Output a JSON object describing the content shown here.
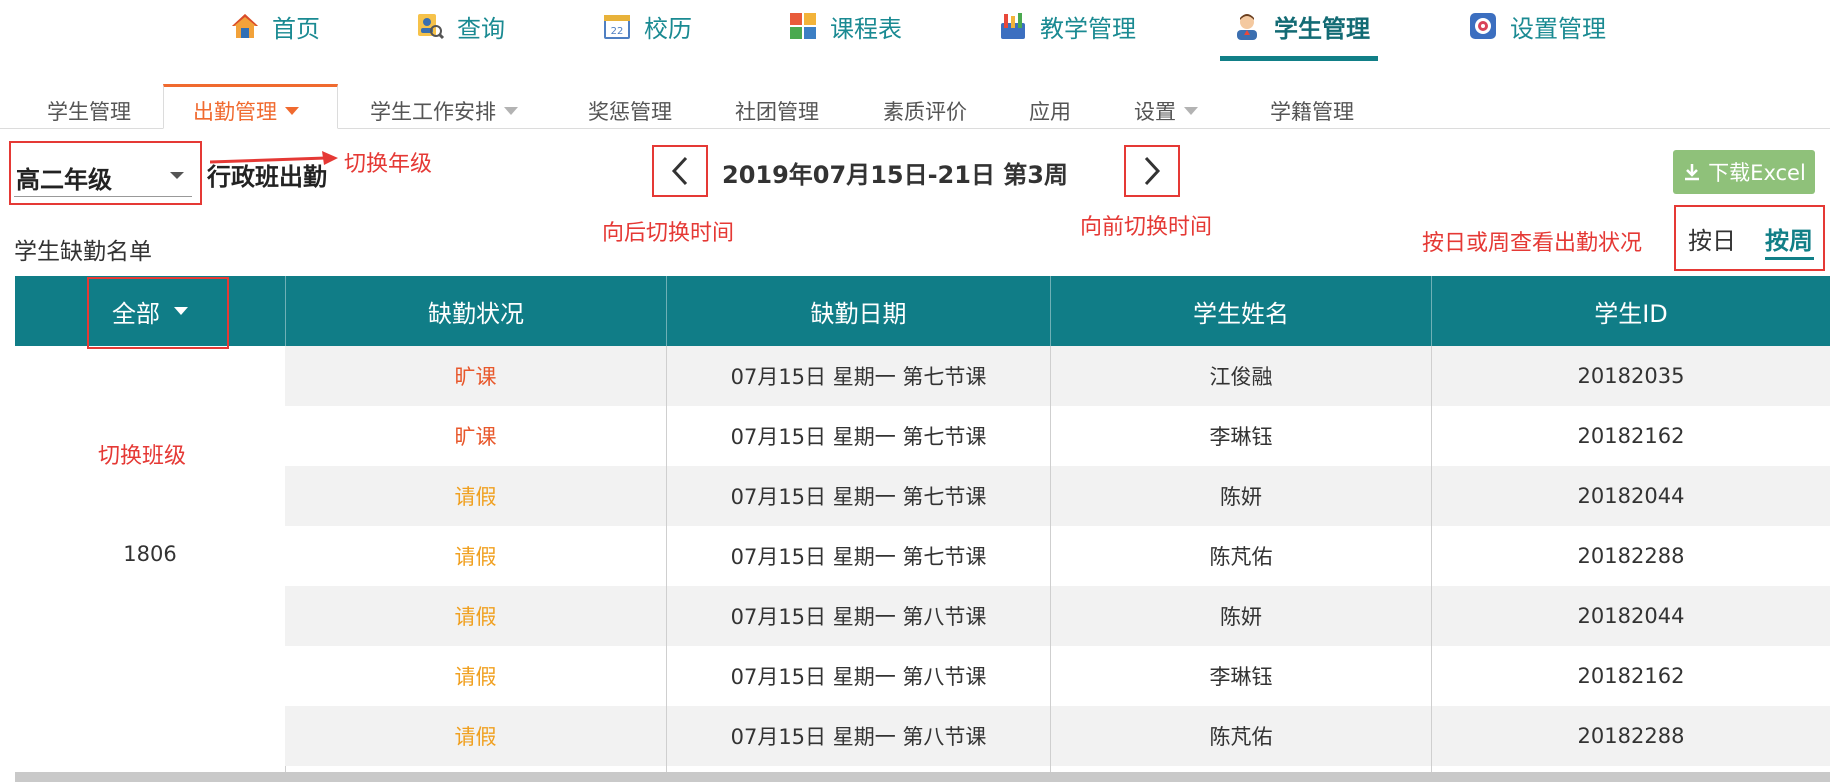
{
  "top_nav": {
    "items": [
      {
        "label": "首页",
        "icon": "home-icon"
      },
      {
        "label": "查询",
        "icon": "search-user-icon"
      },
      {
        "label": "校历",
        "icon": "calendar-icon"
      },
      {
        "label": "课程表",
        "icon": "timetable-icon"
      },
      {
        "label": "教学管理",
        "icon": "teaching-icon"
      },
      {
        "label": "学生管理",
        "icon": "student-icon"
      },
      {
        "label": "设置管理",
        "icon": "gear-icon"
      }
    ],
    "active_index": 5,
    "accent_color": "#117f87"
  },
  "sub_nav": {
    "items": [
      {
        "label": "学生管理",
        "has_dropdown": false
      },
      {
        "label": "出勤管理",
        "has_dropdown": true
      },
      {
        "label": "学生工作安排",
        "has_dropdown": true
      },
      {
        "label": "奖惩管理",
        "has_dropdown": false
      },
      {
        "label": "社团管理",
        "has_dropdown": false
      },
      {
        "label": "素质评价",
        "has_dropdown": false
      },
      {
        "label": "应用",
        "has_dropdown": false
      },
      {
        "label": "设置",
        "has_dropdown": true
      },
      {
        "label": "学籍管理",
        "has_dropdown": false
      }
    ],
    "active_index": 1,
    "active_color": "#f06a2f"
  },
  "toolbar": {
    "grade_selected": "高二年级",
    "attendance_title": "行政班出勤",
    "date_range": "2019年07月15日-21日 第3周",
    "download_label": "下载Excel",
    "view_day_label": "按日",
    "view_week_label": "按周",
    "absent_list_title": "学生缺勤名单"
  },
  "annotations": {
    "switch_grade": "切换年级",
    "prev_time": "向后切换时间",
    "next_time": "向前切换时间",
    "view_mode": "按日或周查看出勤状况",
    "switch_class": "切换班级"
  },
  "table": {
    "class_filter": "全部",
    "headers": [
      "缺勤状况",
      "缺勤日期",
      "学生姓名",
      "学生ID"
    ],
    "class_name": "1806",
    "rows": [
      {
        "status": "旷课",
        "status_type": "truant",
        "date": "07月15日 星期一 第七节课",
        "name": "江俊融",
        "id": "20182035"
      },
      {
        "status": "旷课",
        "status_type": "truant",
        "date": "07月15日 星期一 第七节课",
        "name": "李琳钰",
        "id": "20182162"
      },
      {
        "status": "请假",
        "status_type": "leave",
        "date": "07月15日 星期一 第七节课",
        "name": "陈妍",
        "id": "20182044"
      },
      {
        "status": "请假",
        "status_type": "leave",
        "date": "07月15日 星期一 第七节课",
        "name": "陈芃佑",
        "id": "20182288"
      },
      {
        "status": "请假",
        "status_type": "leave",
        "date": "07月15日 星期一 第八节课",
        "name": "陈妍",
        "id": "20182044"
      },
      {
        "status": "请假",
        "status_type": "leave",
        "date": "07月15日 星期一 第八节课",
        "name": "李琳钰",
        "id": "20182162"
      },
      {
        "status": "请假",
        "status_type": "leave",
        "date": "07月15日 星期一 第八节课",
        "name": "陈芃佑",
        "id": "20182288"
      }
    ],
    "header_color": "#107d87",
    "truant_color": "#e8582c",
    "leave_color": "#f0a020"
  }
}
